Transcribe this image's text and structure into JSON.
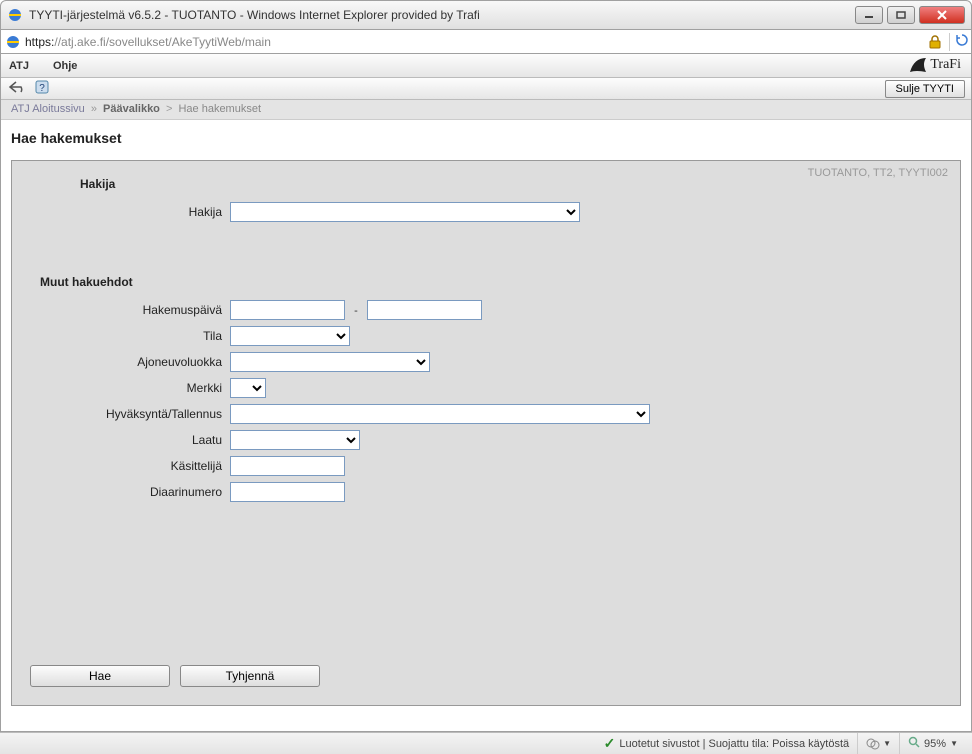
{
  "window": {
    "title": "TYYTI-järjestelmä v6.5.2 - TUOTANTO - Windows Internet Explorer provided by Trafi",
    "url_https": "https:",
    "url_rest": "//atj.ake.fi/sovellukset/AkeTyytiWeb/main"
  },
  "menu": {
    "atj": "ATJ",
    "ohje": "Ohje",
    "brand": "TraFi"
  },
  "toolbar": {
    "close_app": "Sulje TYYTI"
  },
  "breadcrumb": {
    "root": "ATJ Aloitussivu",
    "sep1": "»",
    "mid": "Päävalikko",
    "sep2": ">",
    "leaf": "Hae hakemukset"
  },
  "page": {
    "title": "Hae hakemukset",
    "env_tag": "TUOTANTO, TT2, TYYTI002"
  },
  "sections": {
    "hakija": "Hakija",
    "muut": "Muut hakuehdot"
  },
  "labels": {
    "hakija": "Hakija",
    "hakemuspaiva": "Hakemuspäivä",
    "tila": "Tila",
    "ajoneuvoluokka": "Ajoneuvoluokka",
    "merkki": "Merkki",
    "hyvaksynta": "Hyväksyntä/Tallennus",
    "laatu": "Laatu",
    "kasittelija": "Käsittelijä",
    "diaarinumero": "Diaarinumero",
    "dash": "-"
  },
  "buttons": {
    "hae": "Hae",
    "tyhjenna": "Tyhjennä"
  },
  "status": {
    "trusted": "Luotetut sivustot | Suojattu tila: Poissa käytöstä",
    "zoom": "95%"
  }
}
